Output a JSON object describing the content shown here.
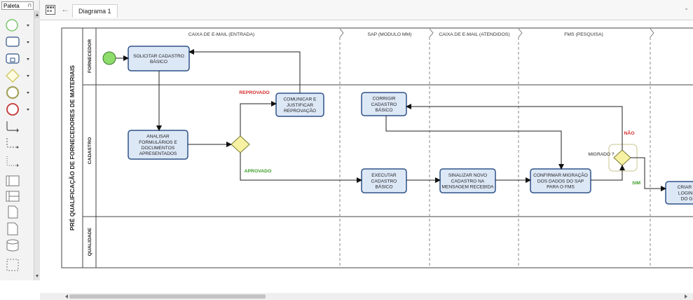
{
  "palette": {
    "title": "Paleta",
    "tools": [
      {
        "name": "start-event-tool",
        "icon": "circle-green"
      },
      {
        "name": "task-tool",
        "icon": "rounded-rect"
      },
      {
        "name": "subprocess-tool",
        "icon": "rect-plus"
      },
      {
        "name": "gateway-tool",
        "icon": "diamond"
      },
      {
        "name": "intermediate-event-tool",
        "icon": "circle-double"
      },
      {
        "name": "end-event-tool",
        "icon": "circle-red"
      },
      {
        "name": "sequence-flow-tool",
        "icon": "connector"
      },
      {
        "name": "message-flow-tool",
        "icon": "dashed-connector"
      },
      {
        "name": "association-tool",
        "icon": "dotted-connector"
      },
      {
        "name": "pool-tool",
        "icon": "pool"
      },
      {
        "name": "lane-tool",
        "icon": "lane"
      },
      {
        "name": "data-object-tool",
        "icon": "document"
      },
      {
        "name": "annotation-tool",
        "icon": "page"
      },
      {
        "name": "data-store-tool",
        "icon": "cylinder"
      },
      {
        "name": "group-tool",
        "icon": "dashed-rect"
      }
    ]
  },
  "tab": {
    "label": "Diagrama 1"
  },
  "colors": {
    "task_fill": "#dde8f7",
    "task_stroke": "#2e5289",
    "start_fill": "#8ddc6c",
    "gateway_fill": "#f6f1a3",
    "rejected": "#d62b2b",
    "approved": "#3c9d28"
  },
  "diagram": {
    "pool": "PRÉ QUALIFICAÇÃO DE FORNECEDORES DE MATERIAIS",
    "lanes": [
      "FORNECEDOR",
      "CADASTRO",
      "QUALIDADE"
    ],
    "phases": [
      "CAIXA DE E-MAIL (ENTRADA)",
      "SAP (MODULO MM)",
      "CAIXA DE E-MAIL (ATENDIDOS)",
      "FMS (PESQUISA)"
    ],
    "tasks": {
      "solicitar": [
        "SOLICITAR CADASTRO",
        "BÁSICO"
      ],
      "analisar": [
        "ANALISAR",
        "FORMULÁRIOS E",
        "DOCUMENTOS",
        "APRESENTADOS"
      ],
      "comunicar": [
        "COMUNICAR E",
        "JUSTIFICAR",
        "REPROVAÇÃO"
      ],
      "corrigir": [
        "CORRIGIR",
        "CADASTRO",
        "BÁSICO"
      ],
      "executar": [
        "EXECUTAR",
        "CADASTRO",
        "BÁSICO"
      ],
      "sinalizar": [
        "SINALIZAR NOVO",
        "CADASTRO NA",
        "MENSAGEM RECEBIDA"
      ],
      "confirmar": [
        "CONFIRMAR MIGRAÇÃO",
        "DOS DADOS  DO SAP",
        "PARA O FMS"
      ],
      "criar": [
        "CRIAR E",
        "LOGIN I",
        "DO G"
      ]
    },
    "labels": {
      "reprovado": "REPROVADO",
      "aprovado": "APROVADO",
      "nao": "NÃO",
      "sim": "SIM",
      "migrado": "MIGRADO ?"
    }
  }
}
